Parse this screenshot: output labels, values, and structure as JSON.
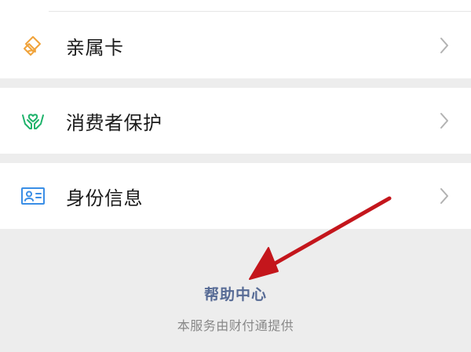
{
  "menu": {
    "items": [
      {
        "label": "亲属卡",
        "icon": "family-card-icon"
      },
      {
        "label": "消费者保护",
        "icon": "consumer-protection-icon"
      },
      {
        "label": "身份信息",
        "icon": "identity-card-icon"
      }
    ]
  },
  "footer": {
    "help_label": "帮助中心",
    "note": "本服务由财付通提供"
  },
  "colors": {
    "background": "#ededed",
    "card": "#ffffff",
    "link": "#576b95",
    "family_icon": "#f0a33b",
    "protection_icon": "#1fb36b",
    "identity_icon": "#3a8ee6",
    "arrow": "#c4161c"
  }
}
